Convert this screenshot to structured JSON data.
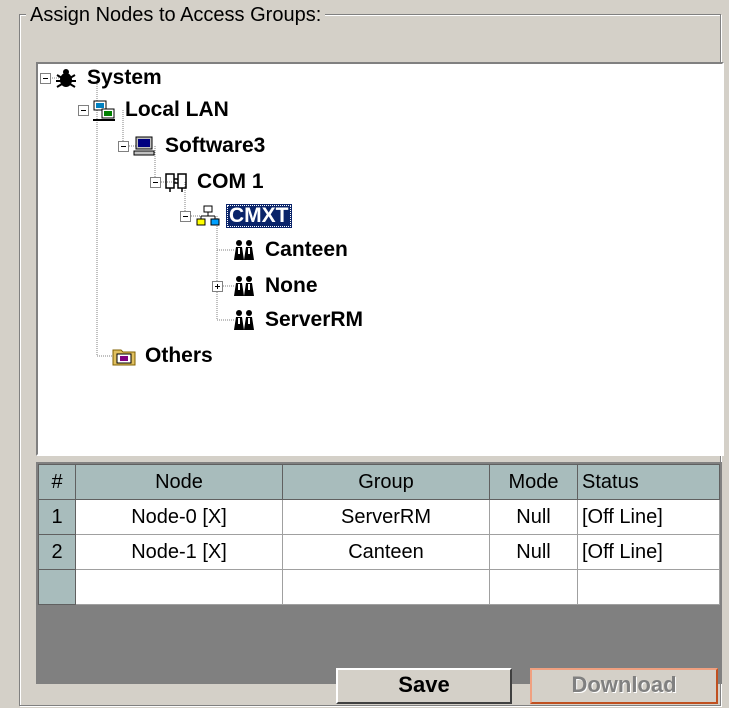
{
  "panel": {
    "title": "Assign Nodes to Access Groups:"
  },
  "tree": {
    "nodes": [
      {
        "label": "System",
        "icon": "bug-icon"
      },
      {
        "label": "Local LAN",
        "icon": "network-icon"
      },
      {
        "label": "Software3",
        "icon": "computer-icon"
      },
      {
        "label": "COM 1",
        "icon": "port-icon"
      },
      {
        "label": "CMXT",
        "icon": "controller-icon",
        "selected": true
      },
      {
        "label": "Canteen",
        "icon": "group-icon"
      },
      {
        "label": "None",
        "icon": "group-icon"
      },
      {
        "label": "ServerRM",
        "icon": "group-icon"
      },
      {
        "label": "Others",
        "icon": "folder-icon"
      }
    ]
  },
  "grid": {
    "columns": [
      "#",
      "Node",
      "Group",
      "Mode",
      "Status"
    ],
    "rows": [
      {
        "num": "1",
        "node": "Node-0 [X]",
        "group": "ServerRM",
        "mode": "Null",
        "status": "[Off Line]"
      },
      {
        "num": "2",
        "node": "Node-1 [X]",
        "group": "Canteen",
        "mode": "Null",
        "status": "[Off Line]"
      }
    ]
  },
  "buttons": {
    "save": "Save",
    "download": "Download"
  },
  "colors": {
    "selection": "#0a246a",
    "header": "#a8bcbc",
    "face": "#d4d0c8"
  }
}
